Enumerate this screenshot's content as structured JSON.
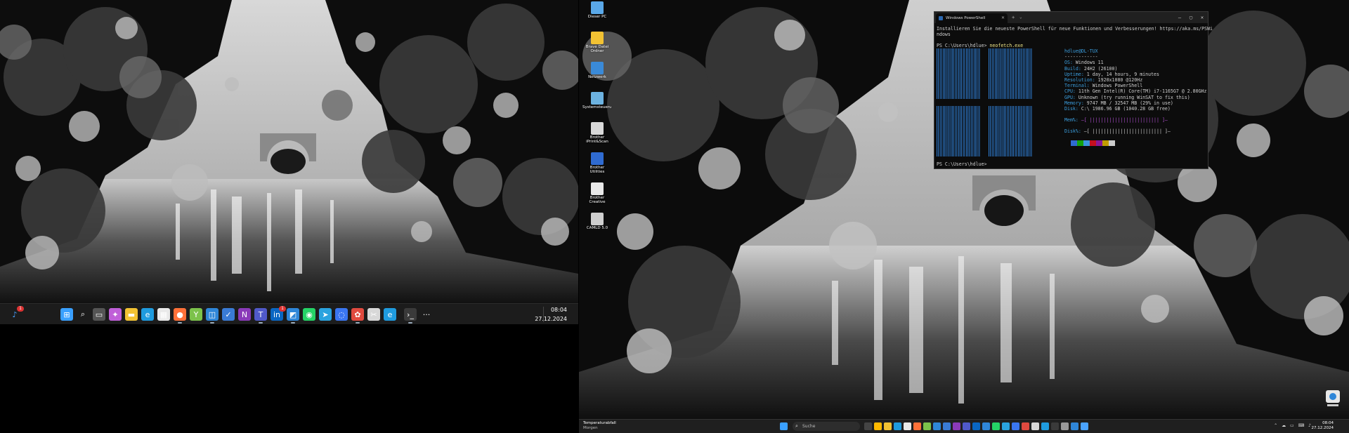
{
  "left_monitor": {
    "taskbar": {
      "widgets_badge": "1",
      "apps": [
        {
          "name": "start-icon",
          "color": "#3aa0ff",
          "glyph": "⊞"
        },
        {
          "name": "search-icon",
          "color": "#1c1c1c",
          "glyph": "⌕"
        },
        {
          "name": "task-view-icon",
          "color": "#555",
          "glyph": "▭"
        },
        {
          "name": "copilot-icon",
          "color": "#c05fd8",
          "glyph": "✦"
        },
        {
          "name": "file-explorer-icon",
          "color": "#f2c233",
          "glyph": "▬"
        },
        {
          "name": "edge-icon",
          "color": "#1f9bde",
          "glyph": "e"
        },
        {
          "name": "store-icon",
          "color": "#e9e9e9",
          "glyph": "▦"
        },
        {
          "name": "firefox-icon",
          "color": "#ff7139",
          "glyph": "●"
        },
        {
          "name": "bittorrent-icon",
          "color": "#7cc24b",
          "glyph": "Y"
        },
        {
          "name": "remote-desktop-icon",
          "color": "#2f86d8",
          "glyph": "◫"
        },
        {
          "name": "todo-icon",
          "color": "#3a7bd5",
          "glyph": "✓"
        },
        {
          "name": "onenote-icon",
          "color": "#8a3ab9",
          "glyph": "N"
        },
        {
          "name": "teams-icon",
          "color": "#5059c9",
          "glyph": "T"
        },
        {
          "name": "linkedin-icon",
          "color": "#0a66c2",
          "glyph": "in"
        },
        {
          "name": "network-app-icon",
          "color": "#2f86d8",
          "glyph": "◩"
        },
        {
          "name": "whatsapp-icon",
          "color": "#25d366",
          "glyph": "◉"
        },
        {
          "name": "telegram-icon",
          "color": "#2aa3df",
          "glyph": "➤"
        },
        {
          "name": "signal-icon",
          "color": "#3a76f0",
          "glyph": "◌"
        },
        {
          "name": "photos-icon",
          "color": "#e04a3f",
          "glyph": "✿"
        },
        {
          "name": "snipping-icon",
          "color": "#d8d8d8",
          "glyph": "✂"
        },
        {
          "name": "edge-beta-icon",
          "color": "#1f9bde",
          "glyph": "e"
        },
        {
          "name": "terminal-icon",
          "color": "#3a3a3a",
          "glyph": "›_"
        },
        {
          "name": "more-icon",
          "color": "#1c1c1c",
          "glyph": "···"
        }
      ],
      "linkedin_badge": "1",
      "time": "08:04",
      "date": "27.12.2024"
    }
  },
  "right_monitor": {
    "desktop_icons": [
      {
        "label": "Dieser PC",
        "color": "#5aa8e8"
      },
      {
        "label": "Brave Datei Ordner",
        "color": "#f2c233"
      },
      {
        "label": "Netzwerk",
        "color": "#3a8ad8"
      },
      {
        "label": "Systemsteuerung",
        "color": "#6cb2e0"
      },
      {
        "label": "Brother iPrint&Scan",
        "color": "#d8d8d8"
      },
      {
        "label": "Brother Utilities",
        "color": "#2f6bd1"
      },
      {
        "label": "Brother Creative Center",
        "color": "#e8e8e8"
      },
      {
        "label": "CAMLD 5.0",
        "color": "#cfcfcf"
      }
    ],
    "powershell": {
      "tab_title": "Windows PowerShell",
      "window_controls": [
        "—",
        "▢",
        "✕"
      ],
      "update_notice_1": "Installieren Sie die neueste PowerShell für neue Funktionen und Verbesserungen! https://aka.ms/PSWi",
      "update_notice_2": "ndows",
      "prompt": "PS C:\\Users\\hdlue>",
      "command": "neofetch.exe",
      "user_host": "hdlue@DL-TUX",
      "separator": "------------",
      "info": [
        {
          "key": "OS:",
          "val": "Windows 11"
        },
        {
          "key": "Build:",
          "val": "24H2 (26100)"
        },
        {
          "key": "Uptime:",
          "val": "1 day, 14 hours, 9 minutes"
        },
        {
          "key": "Resolution:",
          "val": "1920x1080 @120Hz"
        },
        {
          "key": "Terminal:",
          "val": "Windows PowerShell"
        },
        {
          "key": "CPU:",
          "val": "11th Gen Intel(R) Core(TM) i7-1165G7 @ 2.80GHz"
        },
        {
          "key": "GPU:",
          "val": "Unknown (try running WinSAT to fix this)"
        },
        {
          "key": "Memory:",
          "val": "9747 MB / 32547 MB (29% in use)"
        },
        {
          "key": "Disk:",
          "val": "C:\\ 1986.96 GB (1040.28 GB free)"
        }
      ],
      "mem_bar": {
        "key": "Mem%:",
        "val": "—[ ||||||||||||||||||||||||| ]—"
      },
      "disk_bar": {
        "key": "Disk%:",
        "val": "—[ ||||||||||||||||||||||||| ]—"
      },
      "palette": [
        "#0c0c0c",
        "#2f6bd1",
        "#13a10e",
        "#3a96dd",
        "#c50f1f",
        "#881798",
        "#c19c00",
        "#cccccc"
      ],
      "prompt_end": "PS C:\\Users\\hdlue>"
    },
    "taskbar": {
      "weather_title": "Temperaturabfall",
      "weather_sub": "Morgen",
      "search_placeholder": "Suche",
      "tray": "⌃ ☁ ▭ ⌨ ♪",
      "time": "08:04",
      "date": "27.12.2024",
      "apps": [
        "#444",
        "#ffb900",
        "#f2c233",
        "#1f9bde",
        "#e9e9e9",
        "#ff7139",
        "#7cc24b",
        "#2f86d8",
        "#3a7bd5",
        "#8a3ab9",
        "#5059c9",
        "#0a66c2",
        "#2f86d8",
        "#25d366",
        "#2aa3df",
        "#3a76f0",
        "#e04a3f",
        "#d8d8d8",
        "#1f9bde",
        "#3a3a3a",
        "#999",
        "#2f86d8",
        "#4aa3ff"
      ]
    }
  }
}
